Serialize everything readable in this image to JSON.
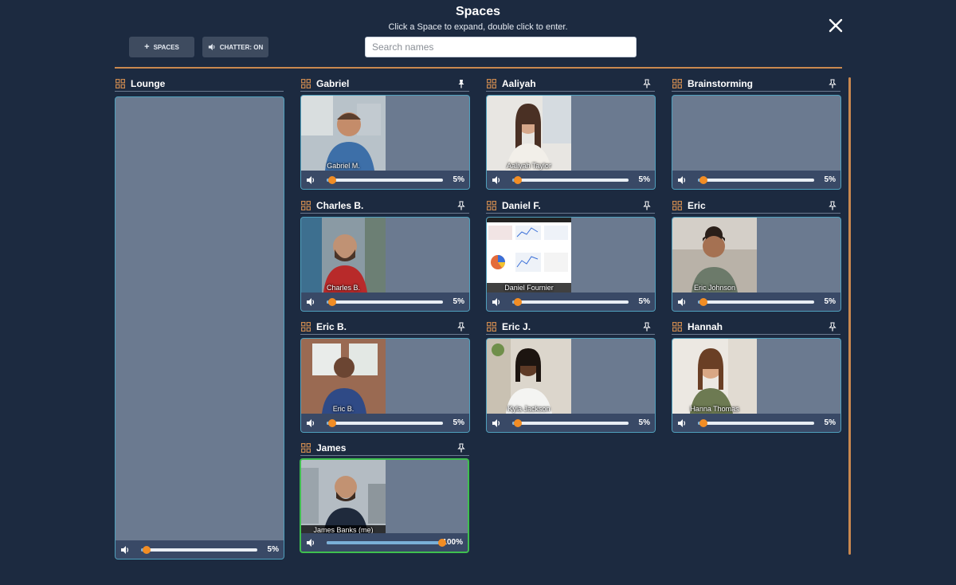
{
  "header": {
    "title": "Spaces",
    "subtitle": "Click a Space to expand, double click to enter."
  },
  "toolbar": {
    "spaces_label": "SPACES",
    "chatter_label": "CHATTER: ON"
  },
  "search": {
    "placeholder": "Search names"
  },
  "colors": {
    "background": "#1c2a40",
    "accent": "#c9884f",
    "card": "#6b7a90",
    "slider_knob": "#f28d24",
    "active_border": "#3fbf4f"
  },
  "lounge": {
    "name": "Lounge",
    "volume": "5%"
  },
  "spaces": [
    {
      "name": "Gabriel",
      "participant": "Gabriel M.",
      "volume": "5%"
    },
    {
      "name": "Aaliyah",
      "participant": "Aaliyah Taylor",
      "volume": "5%"
    },
    {
      "name": "Brainstorming",
      "participant": "",
      "volume": "5%"
    },
    {
      "name": "Charles B.",
      "participant": "Charles B.",
      "volume": "5%"
    },
    {
      "name": "Daniel F.",
      "participant": "Daniel Fournier",
      "volume": "5%"
    },
    {
      "name": "Eric",
      "participant": "Eric Johnson",
      "volume": "5%"
    },
    {
      "name": "Eric B.",
      "participant": "Eric B.",
      "volume": "5%"
    },
    {
      "name": "Eric J.",
      "participant": "Kyla Jackson",
      "volume": "5%"
    },
    {
      "name": "Hannah",
      "participant": "Hanna Thomas",
      "volume": "5%"
    },
    {
      "name": "James",
      "participant": "James Banks (me)",
      "volume": "100%"
    }
  ]
}
